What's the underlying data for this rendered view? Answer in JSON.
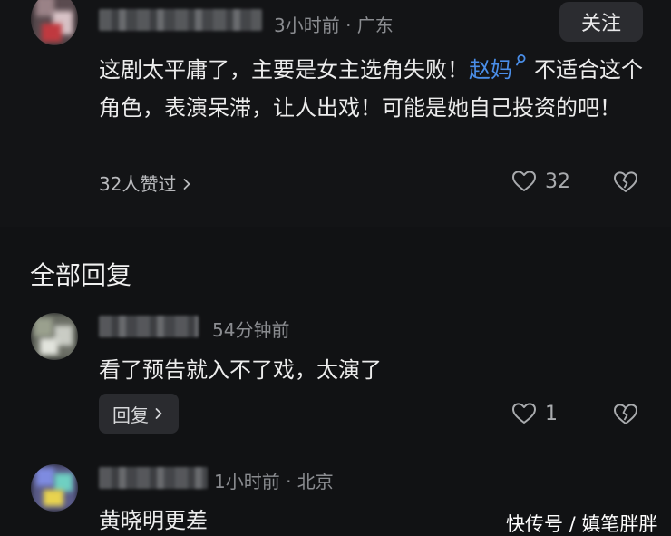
{
  "top_comment": {
    "meta": "3小时前 · 广东",
    "follow_label": "关注",
    "text_before": "这剧太平庸了，主要是女主选角失败！",
    "mention": "赵妈",
    "text_after": "不适合这个角色，表演呆滞，让人出戏！可能是她自己投资的吧！",
    "likers": "32人赞过",
    "like_count": "32"
  },
  "section_title": "全部回复",
  "replies": [
    {
      "meta": "54分钟前",
      "text": "看了预告就入不了戏，太演了",
      "reply_label": "回复",
      "like_count": "1"
    },
    {
      "meta": "1小时前 · 北京",
      "text": "黄晓明更差"
    }
  ],
  "watermark": "快传号 / 嫃笔胖胖",
  "colors": {
    "background": "#111214",
    "accent": "#4a8ee8",
    "secondary_text": "#8a8c90"
  },
  "icons": [
    "heart-icon",
    "broken-heart-icon",
    "chevron-right-icon",
    "search-small-icon"
  ]
}
